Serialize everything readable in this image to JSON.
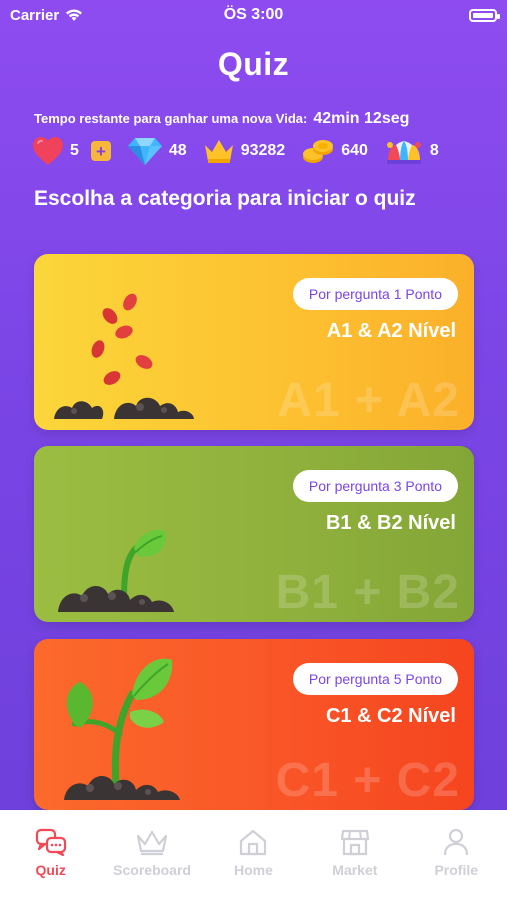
{
  "status": {
    "carrier": "Carrier",
    "time": "ÖS 3:00"
  },
  "header": {
    "title": "Quiz"
  },
  "life_timer": {
    "label": "Tempo restante para ganhar uma nova Vida:",
    "value": "42min 12seg"
  },
  "stats": {
    "lives": "5",
    "gems": "48",
    "crowns": "93282",
    "coins": "640",
    "jokers": "8"
  },
  "section": {
    "heading": "Escolha a categoria para iniciar o quiz"
  },
  "categories": [
    {
      "points": "Por pergunta 1 Ponto",
      "level": "A1 & A2 Nível",
      "watermark": "A1 + A2"
    },
    {
      "points": "Por pergunta 3 Ponto",
      "level": "B1 & B2 Nível",
      "watermark": "B1 + B2"
    },
    {
      "points": "Por pergunta 5 Ponto",
      "level": "C1 & C2 Nível",
      "watermark": "C1 + C2"
    }
  ],
  "tabs": [
    {
      "label": "Quiz",
      "icon": "quiz-icon",
      "active": true
    },
    {
      "label": "Scoreboard",
      "icon": "crown-icon",
      "active": false
    },
    {
      "label": "Home",
      "icon": "home-icon",
      "active": false
    },
    {
      "label": "Market",
      "icon": "store-icon",
      "active": false
    },
    {
      "label": "Profile",
      "icon": "user-icon",
      "active": false
    }
  ],
  "colors": {
    "background": "#7b45e6",
    "card_a": "#fdc030",
    "card_b": "#8fb03c",
    "card_c": "#f95427",
    "active_tab": "#f14a56"
  }
}
